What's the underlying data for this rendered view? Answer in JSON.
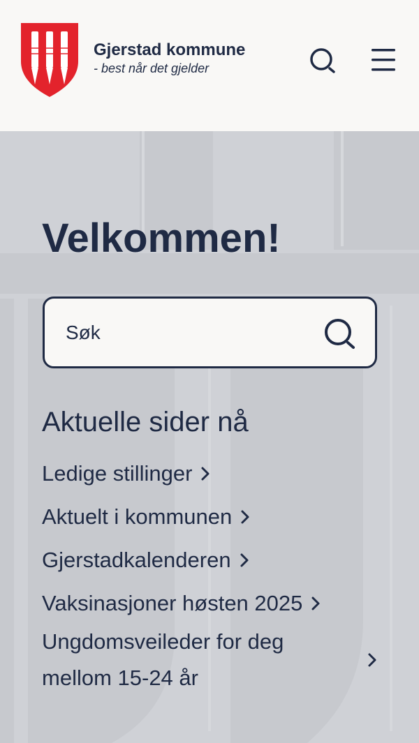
{
  "header": {
    "brand_name": "Gjerstad kommune",
    "tagline": "- best når det gjelder",
    "logo_icon": "coat-of-arms-knives-icon",
    "search_icon": "search-icon",
    "menu_icon": "hamburger-menu-icon"
  },
  "hero": {
    "title": "Velkommen!",
    "search": {
      "placeholder": "Søk",
      "value": "",
      "icon": "search-icon"
    }
  },
  "current_pages": {
    "title": "Aktuelle sider nå",
    "links": [
      {
        "label": "Ledige stillinger"
      },
      {
        "label": "Aktuelt i kommunen"
      },
      {
        "label": "Gjerstadkalenderen"
      },
      {
        "label": "Vaksinasjoner høsten 2025"
      },
      {
        "label": "Ungdomsveileder for deg mellom 15-24 år"
      }
    ]
  },
  "colors": {
    "primary_text": "#1f2a44",
    "header_bg": "#f9f8f6",
    "hero_bg": "#cfd1d6",
    "logo_red": "#e3232c"
  }
}
